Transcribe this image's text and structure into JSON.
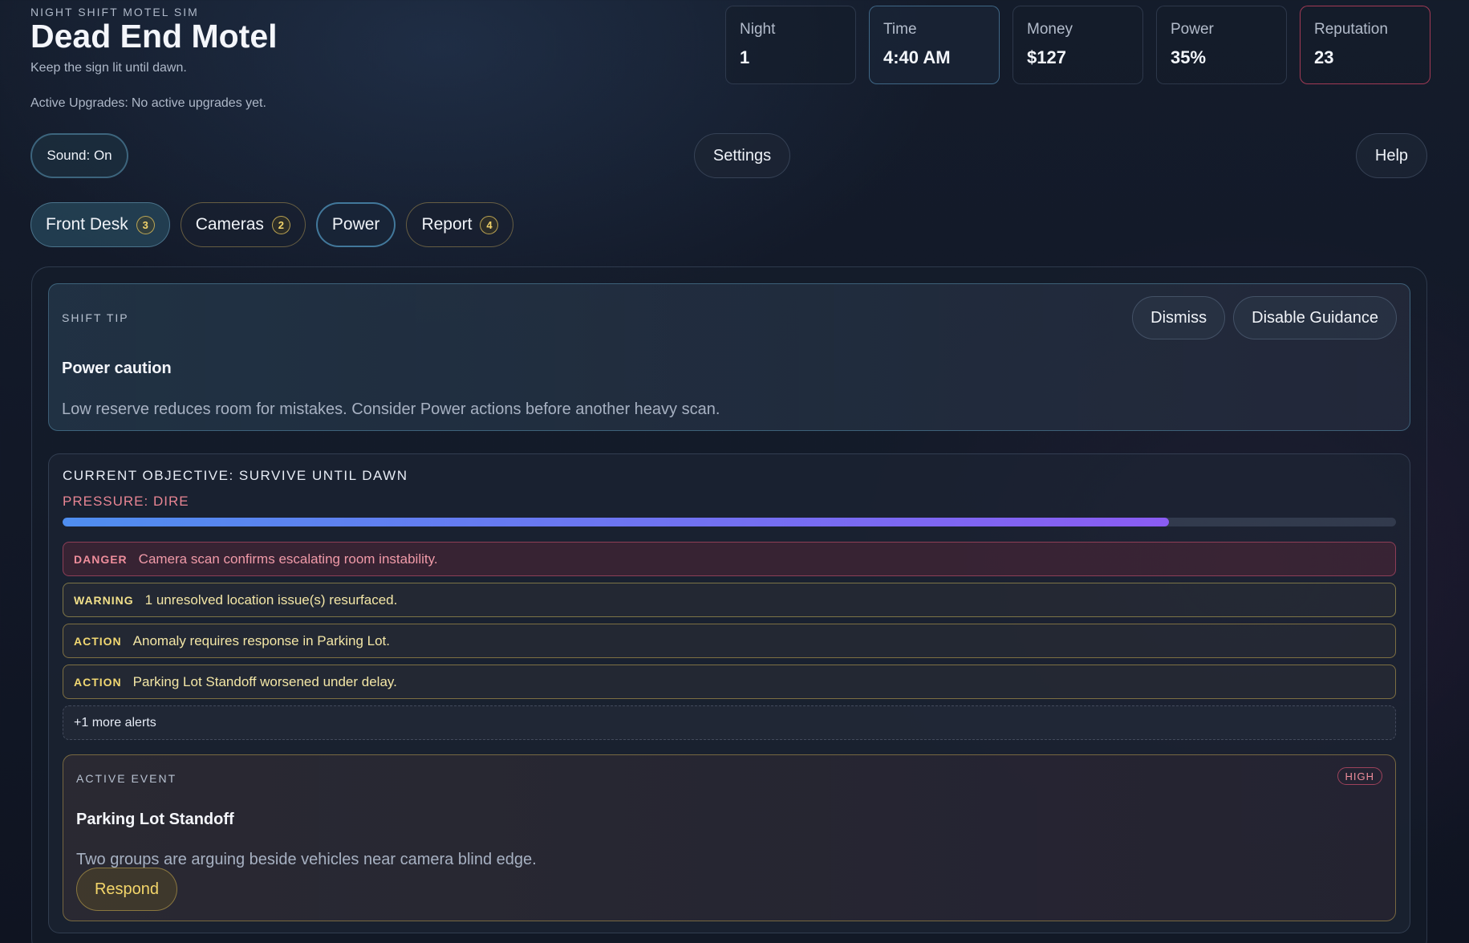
{
  "header": {
    "kicker": "NIGHT SHIFT MOTEL SIM",
    "title": "Dead End Motel",
    "subtitle": "Keep the sign lit until dawn.",
    "upgrades_label": "Active Upgrades:",
    "upgrades_value": "No active upgrades yet."
  },
  "stats": {
    "night": {
      "label": "Night",
      "value": "1"
    },
    "time": {
      "label": "Time",
      "value": "4:40 AM"
    },
    "money": {
      "label": "Money",
      "value": "$127"
    },
    "power": {
      "label": "Power",
      "value": "35%"
    },
    "reputation": {
      "label": "Reputation",
      "value": "23"
    }
  },
  "controls": {
    "sound_label": "Sound: On",
    "settings_label": "Settings",
    "help_label": "Help"
  },
  "tabs": [
    {
      "label": "Front Desk",
      "badge": "3"
    },
    {
      "label": "Cameras",
      "badge": "2"
    },
    {
      "label": "Power",
      "badge": ""
    },
    {
      "label": "Report",
      "badge": "4"
    }
  ],
  "tip": {
    "kicker": "SHIFT TIP",
    "title": "Power caution",
    "body": "Low reserve reduces room for mistakes. Consider Power actions before another heavy scan.",
    "dismiss_label": "Dismiss",
    "disable_label": "Disable Guidance"
  },
  "objective": {
    "title": "CURRENT OBJECTIVE: SURVIVE UNTIL DAWN",
    "pressure": "PRESSURE: DIRE",
    "progress": 0.83
  },
  "alerts": [
    {
      "level": "DANGER",
      "text": "Camera scan confirms escalating room instability."
    },
    {
      "level": "WARNING",
      "text": "1 unresolved location issue(s) resurfaced."
    },
    {
      "level": "ACTION",
      "text": "Anomaly requires response in Parking Lot."
    },
    {
      "level": "ACTION",
      "text": "Parking Lot Standoff worsened under delay."
    }
  ],
  "more_alerts": "+1 more alerts",
  "event": {
    "kicker": "ACTIVE EVENT",
    "severity": "HIGH",
    "title": "Parking Lot Standoff",
    "body": "Two groups are arguing beside vehicles near camera blind edge.",
    "respond_label": "Respond"
  }
}
